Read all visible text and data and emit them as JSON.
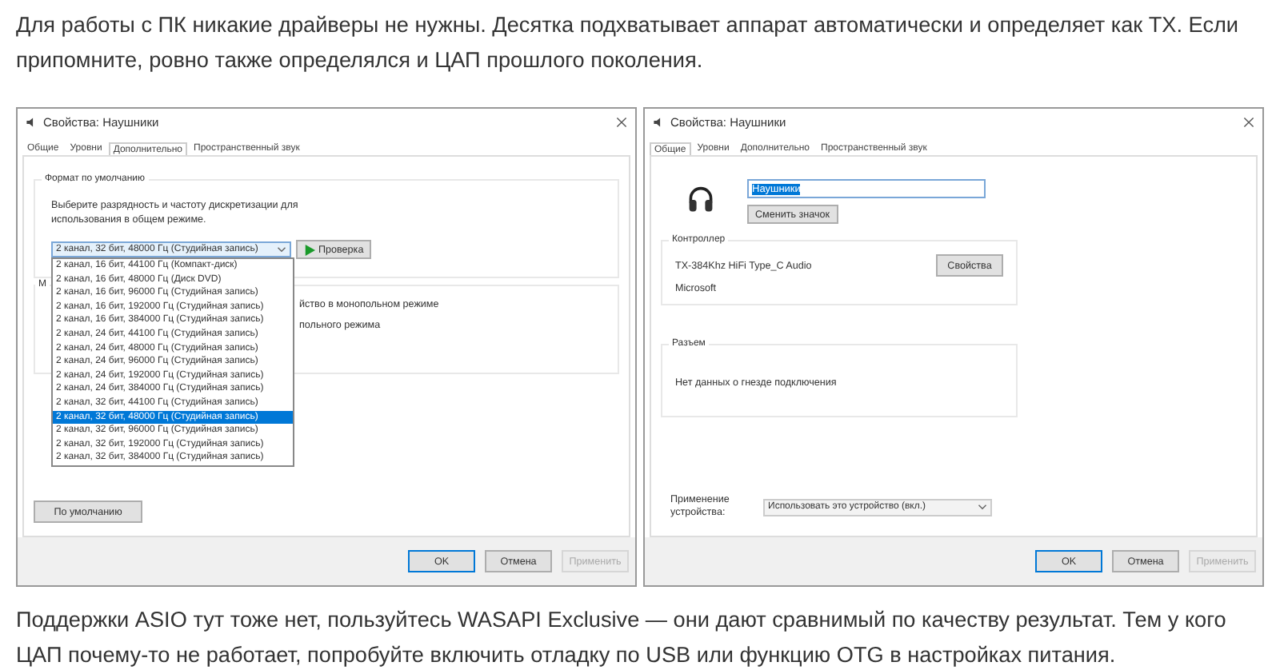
{
  "intro": "Для работы с ПК никакие драйверы не нужны. Десятка подхватывает аппарат автоматически и определяет как TX. Если припомните, ровно также определялся и ЦАП прошлого поколения.",
  "advanced_dialog": {
    "title": "Свойства: Наушники",
    "tabs": [
      {
        "label": "Общие",
        "selected": false
      },
      {
        "label": "Уровни",
        "selected": false
      },
      {
        "label": "Дополнительно",
        "selected": true
      },
      {
        "label": "Пространственный звук",
        "selected": false
      }
    ],
    "format_group": {
      "legend": "Формат по умолчанию",
      "description": "Выберите разрядность и частоту дискретизации для использования в общем режиме.",
      "test_button": "Проверка",
      "format_select": {
        "value": "2 канал, 32 бит, 48000 Гц (Студийная запись)",
        "expanded": true,
        "options": [
          {
            "label": "2 канал, 16 бит, 44100 Гц (Компакт-диск)",
            "selected": false
          },
          {
            "label": "2 канал, 16 бит, 48000 Гц (Диск DVD)",
            "selected": false
          },
          {
            "label": "2 канал, 16 бит, 96000 Гц (Студийная запись)",
            "selected": false
          },
          {
            "label": "2 канал, 16 бит, 192000 Гц (Студийная запись)",
            "selected": false
          },
          {
            "label": "2 канал, 16 бит, 384000 Гц (Студийная запись)",
            "selected": false
          },
          {
            "label": "2 канал, 24 бит, 44100 Гц (Студийная запись)",
            "selected": false
          },
          {
            "label": "2 канал, 24 бит, 48000 Гц (Студийная запись)",
            "selected": false
          },
          {
            "label": "2 канал, 24 бит, 96000 Гц (Студийная запись)",
            "selected": false
          },
          {
            "label": "2 канал, 24 бит, 192000 Гц (Студийная запись)",
            "selected": false
          },
          {
            "label": "2 канал, 24 бит, 384000 Гц (Студийная запись)",
            "selected": false
          },
          {
            "label": "2 канал, 32 бит, 44100 Гц (Студийная запись)",
            "selected": false
          },
          {
            "label": "2 канал, 32 бит, 48000 Гц (Студийная запись)",
            "selected": true
          },
          {
            "label": "2 канал, 32 бит, 96000 Гц (Студийная запись)",
            "selected": false
          },
          {
            "label": "2 канал, 32 бит, 192000 Гц (Студийная запись)",
            "selected": false
          },
          {
            "label": "2 канал, 32 бит, 384000 Гц (Студийная запись)",
            "selected": false
          }
        ]
      }
    },
    "exclusive_group": {
      "legend_fragment": "М",
      "line_fragments": [
        "йство в монопольном режиме",
        "польного режима"
      ]
    },
    "default_button": "По умолчанию",
    "footer_buttons": [
      {
        "label": "OK",
        "default": true,
        "disabled": false
      },
      {
        "label": "Отмена",
        "default": false,
        "disabled": false
      },
      {
        "label": "Применить",
        "default": false,
        "disabled": true
      }
    ]
  },
  "general_dialog": {
    "title": "Свойства: Наушники",
    "tabs": [
      {
        "label": "Общие",
        "selected": true
      },
      {
        "label": "Уровни",
        "selected": false
      },
      {
        "label": "Дополнительно",
        "selected": false
      },
      {
        "label": "Пространственный звук",
        "selected": false
      }
    ],
    "name_field": {
      "value": "Наушники",
      "highlighted": true
    },
    "change_icon_button": "Сменить значок",
    "controller_group": {
      "legend": "Контроллер",
      "device": "TX-384Khz HiFi Type_C Audio",
      "manufacturer": "Microsoft",
      "properties_button": "Свойства"
    },
    "jack_group": {
      "legend": "Разъем",
      "text": "Нет данных о гнезде подключения"
    },
    "usage": {
      "label": "Применение устройства:",
      "value": "Использовать это устройство (вкл.)"
    },
    "footer_buttons": [
      {
        "label": "OK",
        "default": true,
        "disabled": false
      },
      {
        "label": "Отмена",
        "default": false,
        "disabled": false
      },
      {
        "label": "Применить",
        "default": false,
        "disabled": true
      }
    ]
  },
  "outro": "Поддержки ASIO тут тоже нет, пользуйтесь WASAPI Exclusive — они дают сравнимый по качеству результат. Тем у кого ЦАП почему-то не работает, попробуйте включить отладку по USB или функцию OTG в настройках питания."
}
